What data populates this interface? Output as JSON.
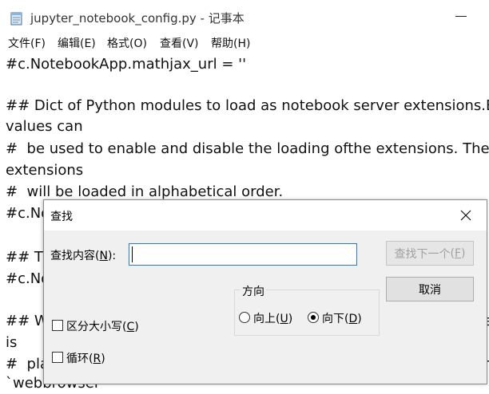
{
  "window": {
    "title": "jupyter_notebook_config.py - 记事本",
    "accent_color": "#6c3a9b"
  },
  "menu": [
    {
      "label": "文件(F)"
    },
    {
      "label": "编辑(E)"
    },
    {
      "label": "格式(O)"
    },
    {
      "label": "查看(V)"
    },
    {
      "label": "帮助(H)"
    }
  ],
  "editor": {
    "lines": [
      "#c.NotebookApp.mathjax_url = ''",
      "",
      "## Dict of Python modules to load as notebook server extensions.E",
      "values can",
      "#  be used to enable and disable the loading ofthe extensions. The",
      "extensions",
      "#  will be loaded in alphabetical order.",
      "#c.No",
      "",
      "## Th",
      "#c.No",
      "",
      "## W",
      "is",
      "#  pla",
      "`webbrowser`"
    ],
    "right_fragments": {
      "line13": "se",
      "line15": "or"
    }
  },
  "find_dialog": {
    "title": "查找",
    "find_label": "查找内容",
    "find_label_key": "N",
    "find_value": "",
    "find_next_label": "查找下一个",
    "find_next_key": "F",
    "cancel_label": "取消",
    "direction_label": "方向",
    "up_label": "向上",
    "up_key": "U",
    "down_label": "向下",
    "down_key": "D",
    "direction_selected": "down",
    "match_case_label": "区分大小写",
    "match_case_key": "C",
    "match_case_checked": false,
    "wrap_label": "循环",
    "wrap_key": "R",
    "wrap_checked": false
  }
}
